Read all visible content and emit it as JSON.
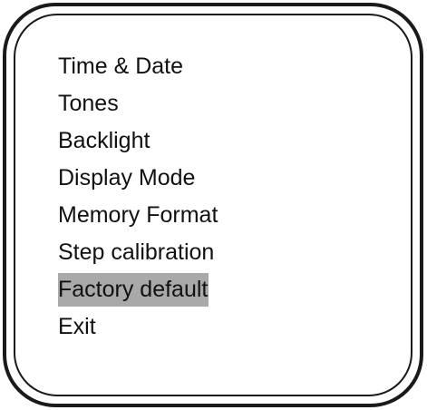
{
  "menu": {
    "items": [
      {
        "label": "Time & Date",
        "selected": false
      },
      {
        "label": "Tones",
        "selected": false
      },
      {
        "label": "Backlight",
        "selected": false
      },
      {
        "label": "Display Mode",
        "selected": false
      },
      {
        "label": "Memory Format",
        "selected": false
      },
      {
        "label": "Step calibration",
        "selected": false
      },
      {
        "label": "Factory default",
        "selected": true
      },
      {
        "label": "Exit",
        "selected": false
      }
    ]
  },
  "colors": {
    "frame": "#1a1a1a",
    "selection_highlight": "#a9a9a9",
    "text": "#111111",
    "background": "#ffffff"
  }
}
